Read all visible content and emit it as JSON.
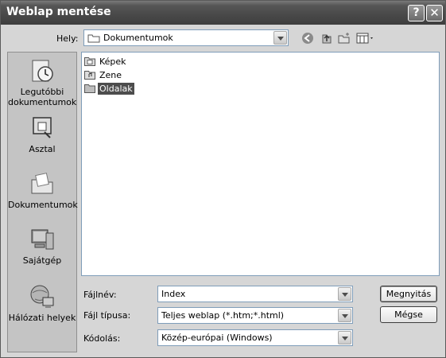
{
  "window": {
    "title": "Weblap mentése"
  },
  "titlebar_buttons": {
    "help": "?",
    "close": "✕"
  },
  "location": {
    "label": "Hely:",
    "value": "Dokumentumok",
    "icon": "folder-icon"
  },
  "toolbar": {
    "back_icon": "back-arrow-icon",
    "up_icon": "up-folder-icon",
    "new_folder_icon": "new-folder-icon",
    "views_icon": "views-menu-icon"
  },
  "places": [
    {
      "label": "Legutóbbi dokumentumok",
      "icon": "recent-documents-icon"
    },
    {
      "label": "Asztal",
      "icon": "desktop-icon"
    },
    {
      "label": "Dokumentumok",
      "icon": "my-documents-icon"
    },
    {
      "label": "Sajátgép",
      "icon": "my-computer-icon"
    },
    {
      "label": "Hálózati helyek",
      "icon": "network-places-icon"
    }
  ],
  "files": [
    {
      "name": "Képek",
      "icon": "pictures-folder-icon",
      "selected": false
    },
    {
      "name": "Zene",
      "icon": "music-folder-icon",
      "selected": false
    },
    {
      "name": "Oldalak",
      "icon": "folder-icon",
      "selected": true
    }
  ],
  "form": {
    "filename_label": "Fájlnév:",
    "filename_value": "Index",
    "filetype_label": "Fájl típusa:",
    "filetype_value": "Teljes weblap (*.htm;*.html)",
    "encoding_label": "Kódolás:",
    "encoding_value": "Közép-európai (Windows)"
  },
  "buttons": {
    "save": "Megnyitás",
    "cancel": "Mégse"
  },
  "colors": {
    "titlebar": "#4a4a4a",
    "selection": "#4d4d4d",
    "dialog_bg": "#d6d6d6"
  }
}
